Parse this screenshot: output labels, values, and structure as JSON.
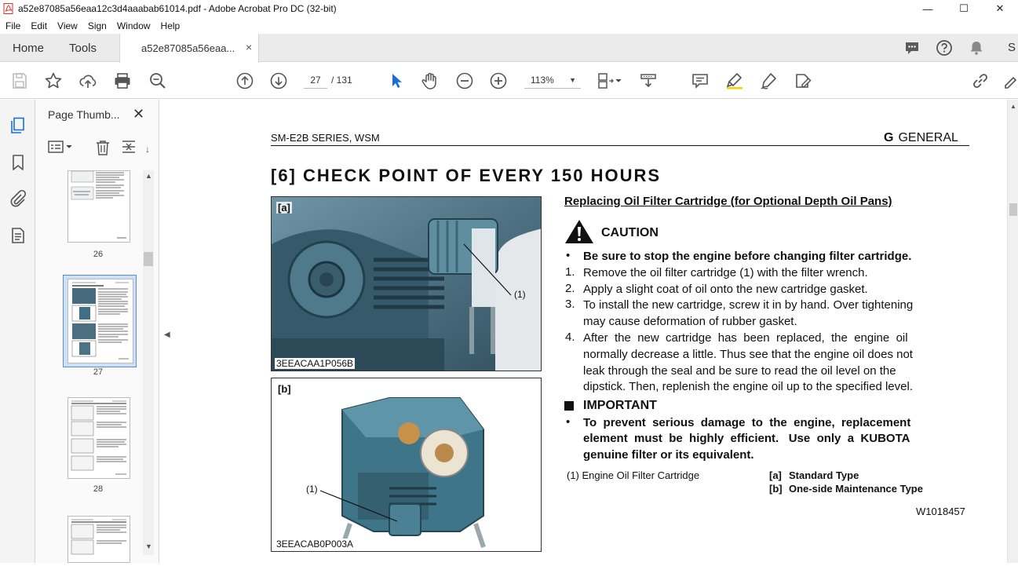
{
  "window": {
    "title": "a52e87085a56eaa12c3d4aaabab61014.pdf - Adobe Acrobat Pro DC (32-bit)",
    "minimize": "—",
    "maximize": "☐",
    "close": "✕"
  },
  "menu": [
    "File",
    "Edit",
    "View",
    "Sign",
    "Window",
    "Help"
  ],
  "tabs": {
    "home": "Home",
    "tools": "Tools",
    "document": "a52e87085a56eaa...",
    "close": "×",
    "sign_in": "S"
  },
  "toolbar": {
    "page_current": "27",
    "page_total": "/  131",
    "zoom": "113%"
  },
  "thumbnails": {
    "title": "Page Thumb...",
    "close": "✕",
    "pages": [
      "26",
      "27",
      "28"
    ],
    "selected": "27"
  },
  "document": {
    "header_left": "SM-E2B  SERIES, WSM",
    "header_section_letter": "G",
    "header_section": "GENERAL",
    "heading": "[6]  CHECK POINT OF EVERY 150 HOURS",
    "section_title": "Replacing Oil Filter Cartridge (for Optional Depth Oil Pans)",
    "caution_label": "CAUTION",
    "caution_bullet": "Be sure to stop the engine before changing filter cartridge.",
    "steps": [
      {
        "n": "1.",
        "lines": [
          "Remove the oil filter cartridge (1) with the filter wrench."
        ]
      },
      {
        "n": "2.",
        "lines": [
          "Apply a slight coat of oil onto the new cartridge gasket."
        ]
      },
      {
        "n": "3.",
        "lines": [
          "To install the new cartridge, screw it in by hand.  Over tightening",
          "may cause deformation of rubber gasket."
        ]
      },
      {
        "n": "4.",
        "lines": [
          "After  the  new  cartridge  has  been  replaced,  the  engine  oil",
          "normally decrease a little.  Thus see that the engine oil does not",
          "leak through the seal and be sure to read the oil level on the",
          "dipstick.  Then, replenish the engine oil up to the specified level."
        ]
      }
    ],
    "important_label": "IMPORTANT",
    "important_lines": [
      "To  prevent  serious  damage  to  the  engine,  replacement",
      "element  must  be  highly  efficient.   Use  only  a  KUBOTA",
      "genuine filter or its equivalent."
    ],
    "legend_item": "(1)  Engine Oil Filter Cartridge",
    "legend_a_tag": "[a]",
    "legend_a": "Standard Type",
    "legend_b_tag": "[b]",
    "legend_b": "One-side Maintenance Type",
    "doc_ref": "W1018457",
    "photo_a": {
      "tag": "[a]",
      "code": "3EEACAA1P056B",
      "callout": "(1)"
    },
    "photo_b": {
      "tag": "[b]",
      "code": "3EEACAB0P003A",
      "callout": "(1)"
    }
  }
}
